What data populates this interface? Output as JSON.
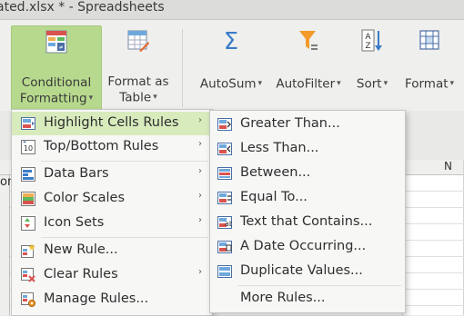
{
  "window": {
    "title": "ated.xlsx * - Spreadsheets"
  },
  "ribbon": {
    "conditional_formatting": {
      "line1": "Conditional",
      "line2": "Formatting",
      "arrow": "▾"
    },
    "format_as_table": {
      "line1": "Format as",
      "line2": "Table",
      "arrow": "▾"
    },
    "autosum": {
      "label": "AutoSum",
      "arrow": "▾"
    },
    "autofilter": {
      "label": "AutoFilter",
      "arrow": "▾"
    },
    "sort": {
      "label": "Sort",
      "arrow": "▾"
    },
    "format": {
      "label": "Format",
      "arrow": "▾"
    }
  },
  "sheet": {
    "column_header_n": "N",
    "partial_cell": "on"
  },
  "cf_menu": {
    "items": [
      {
        "label": "Highlight Cells Rules",
        "icon": "highlight-cells-icon",
        "has_submenu": true,
        "active": true
      },
      {
        "label": "Top/Bottom Rules",
        "icon": "top-bottom-icon",
        "has_submenu": true
      },
      {
        "label": "Data Bars",
        "icon": "data-bars-icon",
        "has_submenu": true
      },
      {
        "label": "Color Scales",
        "icon": "color-scales-icon",
        "has_submenu": true
      },
      {
        "label": "Icon Sets",
        "icon": "icon-sets-icon",
        "has_submenu": true
      },
      {
        "label": "New Rule...",
        "icon": "new-rule-icon",
        "has_submenu": false
      },
      {
        "label": "Clear Rules",
        "icon": "clear-rules-icon",
        "has_submenu": true
      },
      {
        "label": "Manage Rules...",
        "icon": "manage-rules-icon",
        "has_submenu": false
      }
    ],
    "submenu_arrow": "›"
  },
  "highlight_submenu": {
    "items": [
      {
        "label": "Greater Than...",
        "icon": "greater-than-icon"
      },
      {
        "label": "Less Than...",
        "icon": "less-than-icon"
      },
      {
        "label": "Between...",
        "icon": "between-icon"
      },
      {
        "label": "Equal To...",
        "icon": "equal-to-icon"
      },
      {
        "label": "Text that Contains...",
        "icon": "text-contains-icon"
      },
      {
        "label": "A Date Occurring...",
        "icon": "date-occurring-icon"
      },
      {
        "label": "Duplicate Values...",
        "icon": "duplicate-values-icon"
      },
      {
        "label": "More Rules...",
        "icon": ""
      }
    ]
  },
  "colors": {
    "active_green": "#b7d98d",
    "highlight_row": "#d8ebbd",
    "icon_blue": "#3a7cc8",
    "filter_orange": "#f39a2b"
  }
}
